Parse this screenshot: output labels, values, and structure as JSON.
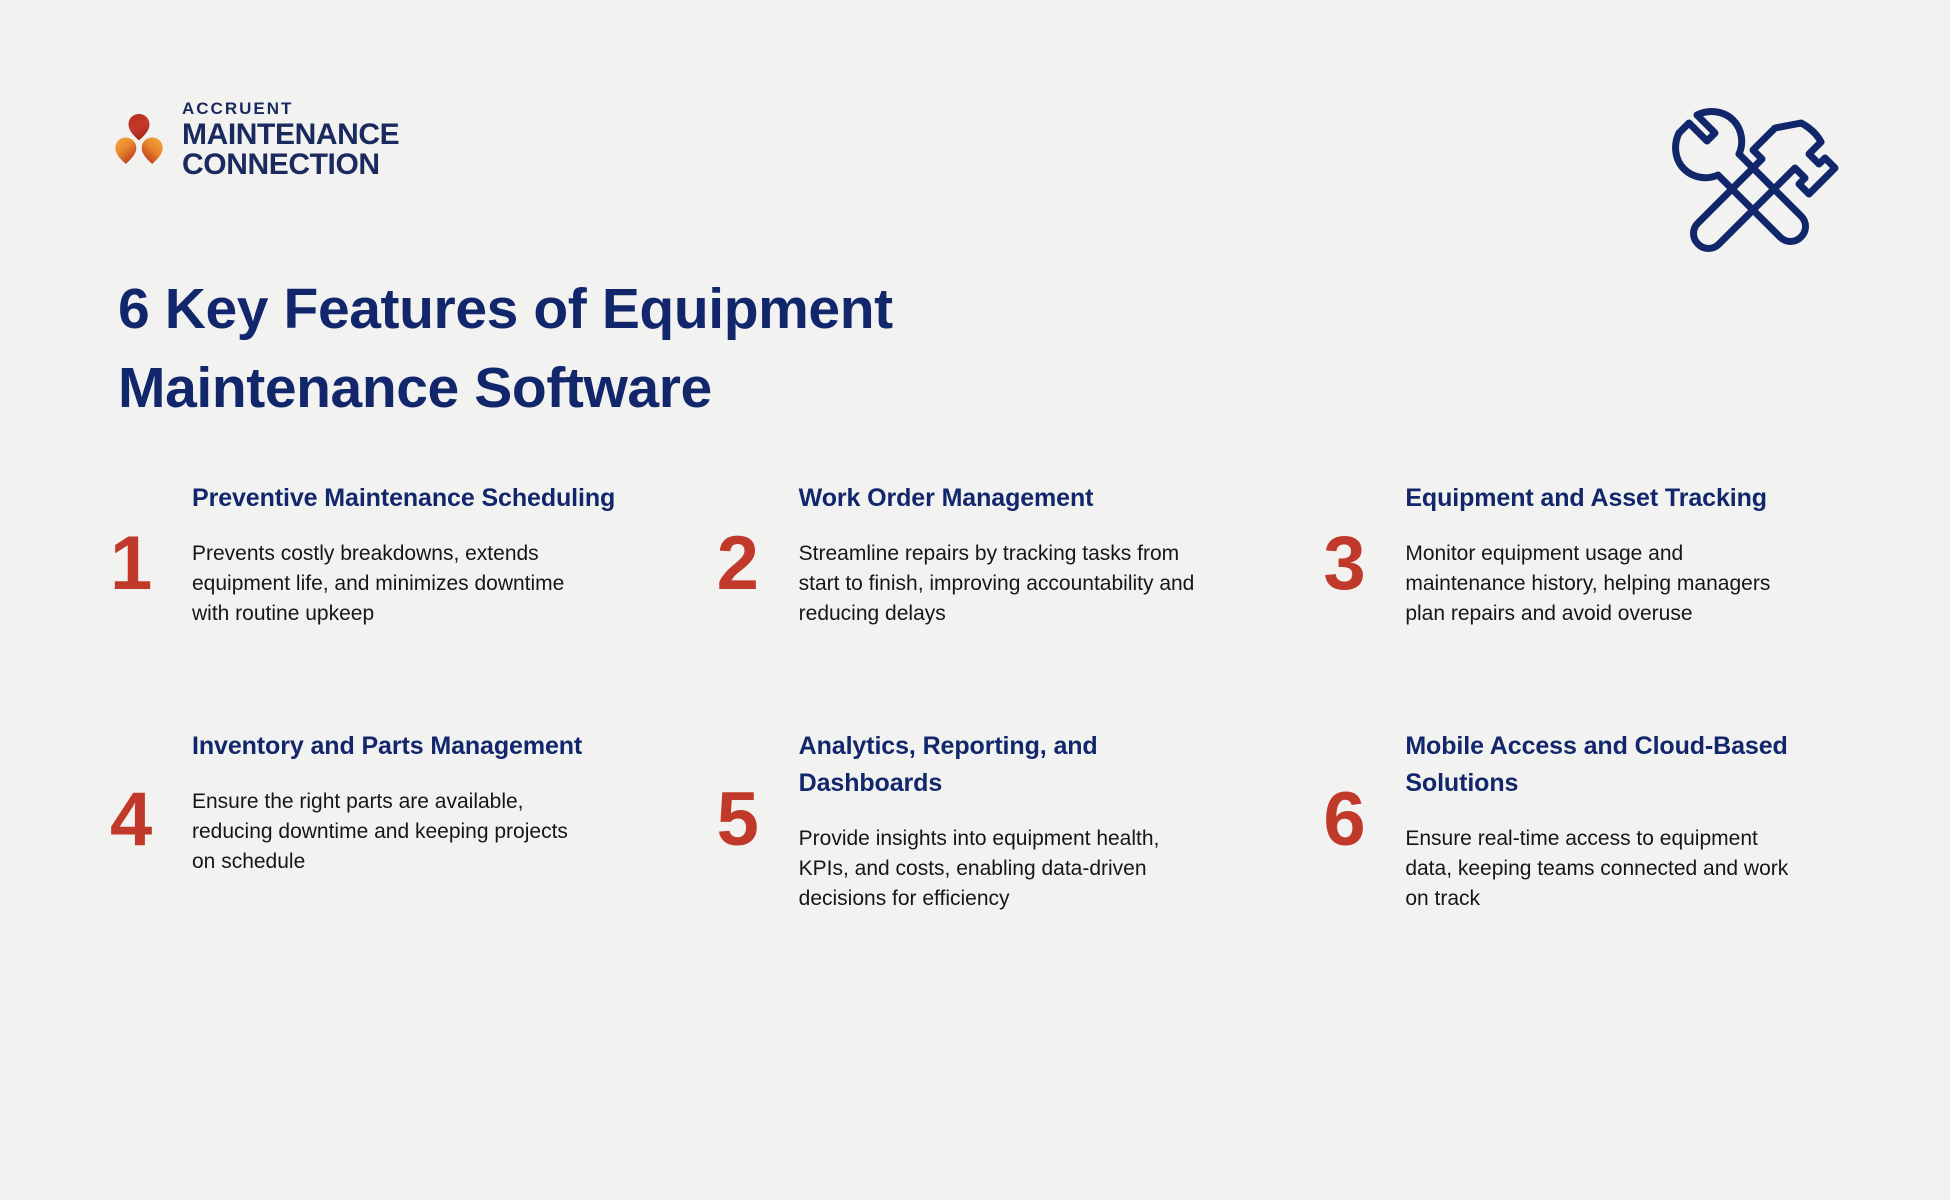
{
  "brand": {
    "logo_eyebrow": "ACCRUENT",
    "logo_line1": "MAINTENANCE",
    "logo_line2": "CONNECTION",
    "navy": "#12276b",
    "red": "#c0392b",
    "background": "#f2f2f1"
  },
  "header": {
    "title": "6 Key Features of Equipment Maintenance Software",
    "decor_icon": "wrench-hammer-icon"
  },
  "features": [
    {
      "number": "1",
      "title": "Preventive Maintenance Scheduling",
      "description": "Prevents costly breakdowns, extends equipment life, and minimizes downtime with routine upkeep"
    },
    {
      "number": "2",
      "title": "Work Order Management",
      "description": "Streamline repairs by tracking tasks from start to finish, improving accountability and reducing delays"
    },
    {
      "number": "3",
      "title": "Equipment and Asset Tracking",
      "description": "Monitor equipment usage and maintenance history, helping managers plan repairs and avoid overuse"
    },
    {
      "number": "4",
      "title": "Inventory and Parts Management",
      "description": "Ensure the right parts are available, reducing downtime and keeping projects on schedule"
    },
    {
      "number": "5",
      "title": "Analytics, Reporting, and Dashboards",
      "description": "Provide insights into equipment health, KPIs, and costs, enabling data-driven decisions for efficiency"
    },
    {
      "number": "6",
      "title": "Mobile Access and Cloud-Based Solutions",
      "description": "Ensure real-time access to equipment data, keeping teams connected and work on track"
    }
  ]
}
